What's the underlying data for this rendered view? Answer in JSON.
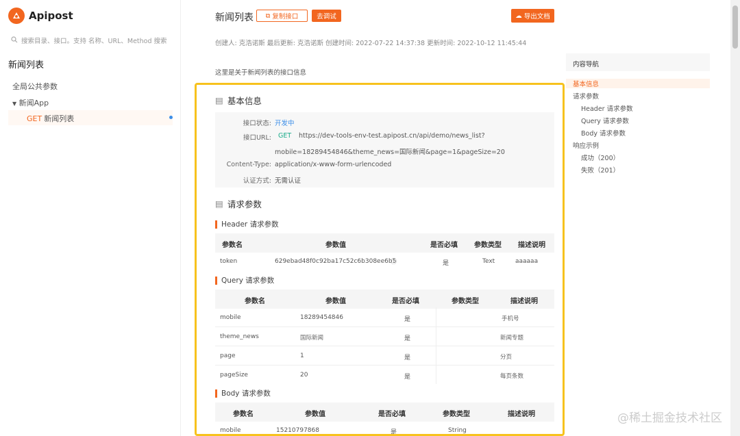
{
  "app": {
    "name": "Apipost"
  },
  "sidebar": {
    "search_placeholder": "搜索目录、接口。支持 名称、URL、Method 搜索",
    "title": "新闻列表",
    "items": [
      {
        "label": "全局公共参数"
      },
      {
        "label": "新闻App"
      },
      {
        "method": "GET",
        "label": "新闻列表"
      }
    ]
  },
  "header": {
    "title": "新闻列表",
    "copy_button": "复制接口",
    "debug_button": "去调试",
    "export_button": "导出文档",
    "meta": "创建人:  克浩诺斯  最后更新:  克浩诺斯  创建时间:  2022-07-22 14:37:38   更新时间:  2022-10-12 11:45:44",
    "description": "这里是关于新闻列表的接口信息"
  },
  "basic": {
    "heading": "基本信息",
    "status_label": "接口状态:",
    "status_value": "开发中",
    "url_label": "接口URL:",
    "url_method": "GET",
    "url_line1": "https://dev-tools-env-test.apipost.cn/api/demo/news_list?",
    "url_line2": "mobile=18289454846&theme_news=国际新闻&page=1&pageSize=20",
    "ctype_label": "Content-Type:",
    "ctype_value": "application/x-www-form-urlencoded",
    "auth_label": "认证方式:",
    "auth_value": "无需认证"
  },
  "request": {
    "heading": "请求参数",
    "header_title": "Header 请求参数",
    "header_cols": [
      "参数名",
      "参数值",
      "是否必填",
      "参数类型",
      "描述说明"
    ],
    "header_rows": [
      {
        "name": "token",
        "value": "629ebad48f0c92ba17c52c6b308ee6b5",
        "required": "是",
        "type": "Text",
        "desc": "aaaaaa"
      }
    ],
    "query_title": "Query 请求参数",
    "query_cols": [
      "参数名",
      "参数值",
      "是否必填",
      "参数类型",
      "描述说明"
    ],
    "query_rows": [
      {
        "name": "mobile",
        "value": "18289454846",
        "required": "是",
        "type": "",
        "desc": "手机号"
      },
      {
        "name": "theme_news",
        "value": "国际新闻",
        "required": "是",
        "type": "",
        "desc": "新闻专题"
      },
      {
        "name": "page",
        "value": "1",
        "required": "是",
        "type": "",
        "desc": "分页"
      },
      {
        "name": "pageSize",
        "value": "20",
        "required": "是",
        "type": "",
        "desc": "每页条数"
      }
    ],
    "body_title": "Body 请求参数",
    "body_cols": [
      "参数名",
      "参数值",
      "是否必填",
      "参数类型",
      "描述说明"
    ],
    "body_rows": [
      {
        "name": "mobile",
        "value": "15210797868",
        "required": "是",
        "type": "String",
        "desc": ""
      }
    ]
  },
  "toc": {
    "title": "内容导航",
    "items": [
      "基本信息",
      "请求参数",
      "Header 请求参数",
      "Query 请求参数",
      "Body 请求参数",
      "响应示例",
      "成功（200）",
      "失败（201）"
    ]
  },
  "watermark": "@稀土掘金技术社区",
  "colors": {
    "accent": "#f2661f",
    "highlight": "#f7c21d",
    "link": "#3b8ee8",
    "method": "#1aab8a"
  }
}
